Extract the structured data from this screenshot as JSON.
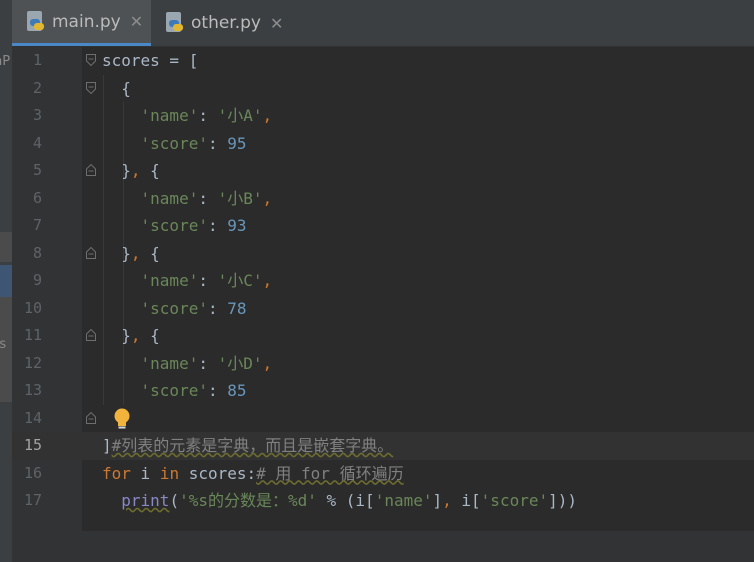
{
  "left_strip": {
    "top_text": "nP",
    "mid_text": "rs"
  },
  "tabs": [
    {
      "label": "main.py",
      "active": true,
      "icon": "python-file-icon"
    },
    {
      "label": "other.py",
      "active": false,
      "icon": "python-file-icon"
    }
  ],
  "editor": {
    "current_line": 15,
    "lines": [
      {
        "no": "1",
        "t": [
          [
            "",
            "scores = ["
          ]
        ]
      },
      {
        "no": "2",
        "t": [
          [
            "",
            "  {"
          ]
        ]
      },
      {
        "no": "3",
        "t": [
          [
            "",
            "    "
          ],
          [
            "s",
            "'name'"
          ],
          [
            "",
            ": "
          ],
          [
            "s",
            "'小A'"
          ],
          [
            "p",
            ","
          ]
        ]
      },
      {
        "no": "4",
        "t": [
          [
            "",
            "    "
          ],
          [
            "s",
            "'score'"
          ],
          [
            "",
            ": "
          ],
          [
            "n",
            "95"
          ]
        ]
      },
      {
        "no": "5",
        "t": [
          [
            "",
            "  }"
          ],
          [
            "p",
            ","
          ],
          [
            "",
            " {"
          ]
        ]
      },
      {
        "no": "6",
        "t": [
          [
            "",
            "    "
          ],
          [
            "s",
            "'name'"
          ],
          [
            "",
            ": "
          ],
          [
            "s",
            "'小B'"
          ],
          [
            "p",
            ","
          ]
        ]
      },
      {
        "no": "7",
        "t": [
          [
            "",
            "    "
          ],
          [
            "s",
            "'score'"
          ],
          [
            "",
            ": "
          ],
          [
            "n",
            "93"
          ]
        ]
      },
      {
        "no": "8",
        "t": [
          [
            "",
            "  }"
          ],
          [
            "p",
            ","
          ],
          [
            "",
            " {"
          ]
        ]
      },
      {
        "no": "9",
        "t": [
          [
            "",
            "    "
          ],
          [
            "s",
            "'name'"
          ],
          [
            "",
            ": "
          ],
          [
            "s",
            "'小C'"
          ],
          [
            "p",
            ","
          ]
        ]
      },
      {
        "no": "10",
        "t": [
          [
            "",
            "    "
          ],
          [
            "s",
            "'score'"
          ],
          [
            "",
            ": "
          ],
          [
            "n",
            "78"
          ]
        ]
      },
      {
        "no": "11",
        "t": [
          [
            "",
            "  }"
          ],
          [
            "p",
            ","
          ],
          [
            "",
            " {"
          ]
        ]
      },
      {
        "no": "12",
        "t": [
          [
            "",
            "    "
          ],
          [
            "s",
            "'name'"
          ],
          [
            "",
            ": "
          ],
          [
            "s",
            "'小D'"
          ],
          [
            "p",
            ","
          ]
        ]
      },
      {
        "no": "13",
        "t": [
          [
            "",
            "    "
          ],
          [
            "s",
            "'score'"
          ],
          [
            "",
            ": "
          ],
          [
            "n",
            "85"
          ]
        ]
      },
      {
        "no": "14",
        "t": [
          [
            "",
            ""
          ]
        ]
      },
      {
        "no": "15",
        "t": [
          [
            "",
            "]"
          ],
          [
            "c",
            "#列表的元素是字典，而且是嵌套字典。"
          ]
        ]
      },
      {
        "no": "16",
        "t": [
          [
            "k",
            "for"
          ],
          [
            "",
            " i "
          ],
          [
            "k",
            "in"
          ],
          [
            "",
            " scores:"
          ],
          [
            "c",
            "# 用 for 循环遍历"
          ]
        ]
      },
      {
        "no": "17",
        "t": [
          [
            "",
            "  "
          ],
          [
            "builtin",
            "print"
          ],
          [
            "",
            "("
          ],
          [
            "s",
            "'%s的分数是：%d'"
          ],
          [
            "",
            " % (i["
          ],
          [
            "s",
            "'name'"
          ],
          [
            "",
            "]"
          ],
          [
            "p",
            ","
          ],
          [
            "",
            " i["
          ],
          [
            "s",
            "'score'"
          ],
          [
            "",
            "]))"
          ]
        ]
      }
    ]
  },
  "colors": {
    "background": "#2b2b2b",
    "keyword": "#cc7832",
    "string": "#6a8759",
    "number": "#6897bb",
    "comment": "#808080",
    "tab_underline": "#4a88c7",
    "bulb": "#f2b33d"
  }
}
